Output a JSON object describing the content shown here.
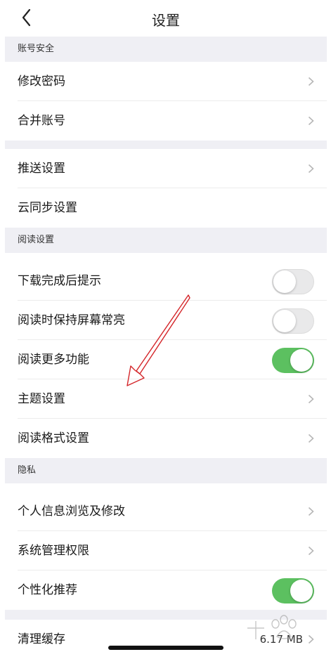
{
  "nav": {
    "title": "设置"
  },
  "sections": {
    "account_security": "账号安全",
    "reading_settings": "阅读设置",
    "privacy": "隐私"
  },
  "rows": {
    "change_password": "修改密码",
    "merge_account": "合并账号",
    "push_settings": "推送设置",
    "cloud_sync": "云同步设置",
    "download_notify": "下载完成后提示",
    "keep_screen_on": "阅读时保持屏幕常亮",
    "more_reading_features": "阅读更多功能",
    "theme_settings": "主题设置",
    "reading_format": "阅读格式设置",
    "personal_info": "个人信息浏览及修改",
    "system_permissions": "系统管理权限",
    "personalized_recommend": "个性化推荐",
    "clear_cache": "清理缓存"
  },
  "values": {
    "cache_size": "6.17 MB"
  },
  "toggles": {
    "download_notify": false,
    "keep_screen_on": false,
    "more_reading_features": true,
    "personalized_recommend": true
  },
  "colors": {
    "toggle_on": "#5cc060",
    "section_bg": "#efeff4",
    "annotation_arrow": "#d4262a"
  },
  "icons": {
    "back": "chevron-left-icon",
    "row_arrow": "chevron-right-icon"
  }
}
